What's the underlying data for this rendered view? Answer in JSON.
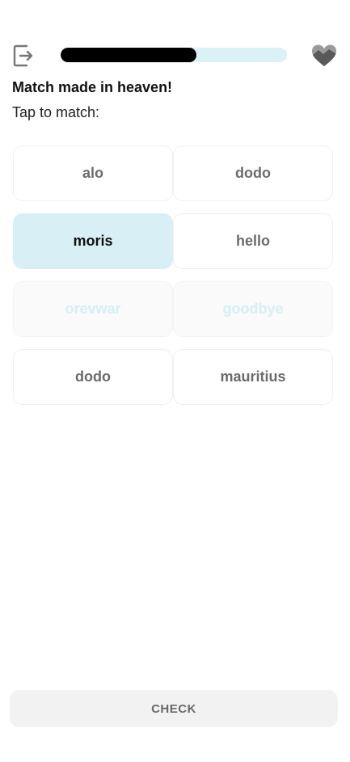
{
  "header": {
    "exit_icon": "exit-icon",
    "progress": 0.6,
    "progress_fill_color": "#000000",
    "progress_track_color": "#daf1f6",
    "lives_icon": "heart-icon"
  },
  "exercise": {
    "title": "Match made in heaven!",
    "instruction": "Tap to match:"
  },
  "tiles": [
    {
      "label": "alo",
      "state": "default"
    },
    {
      "label": "dodo",
      "state": "default"
    },
    {
      "label": "moris",
      "state": "selected"
    },
    {
      "label": "hello",
      "state": "default"
    },
    {
      "label": "orevwar",
      "state": "matched"
    },
    {
      "label": "goodbye",
      "state": "matched"
    },
    {
      "label": "dodo",
      "state": "default"
    },
    {
      "label": "mauritius",
      "state": "default"
    }
  ],
  "footer": {
    "check_label": "CHECK"
  }
}
